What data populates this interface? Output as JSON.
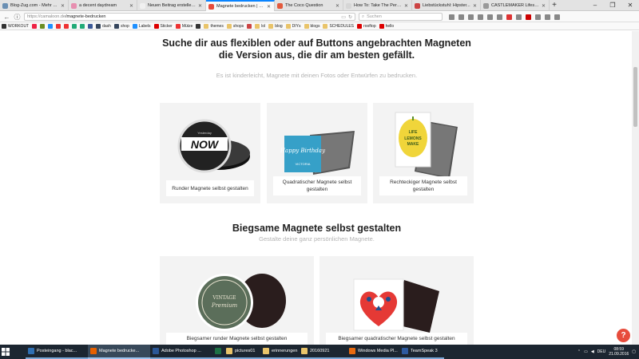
{
  "browser": {
    "tabs": [
      {
        "title": "Blog-Zug.com - Mehr Bes...",
        "color": "#6a8fb3",
        "active": false
      },
      {
        "title": "a decent daydream",
        "color": "#e78fb0",
        "active": false
      },
      {
        "title": "Neuen Beitrag erstellen - a dec...",
        "color": "#f0f0f0",
        "active": false
      },
      {
        "title": "Magnete bedrucken | Ca...",
        "color": "#e74c3c",
        "active": true
      },
      {
        "title": "The Coco Question",
        "color": "#e35a3d",
        "active": false
      },
      {
        "title": "How To: Take The Perfect Flatl...",
        "color": "#d6d6d6",
        "active": false
      },
      {
        "title": "Liebstückstuhl: Hipster...",
        "color": "#c44",
        "active": false
      },
      {
        "title": "CASTLEMAKER Lifestyle-B...",
        "color": "#999",
        "active": false
      }
    ],
    "new_tab": "+",
    "window_controls": [
      "–",
      "❐",
      "✕"
    ],
    "url_host": "https://camaloon.de",
    "url_path": "/magnete-bedrucken",
    "search_placeholder": "Suchen",
    "bookmarks": [
      {
        "label": "WORKOUT",
        "color": "#333"
      },
      {
        "label": "",
        "color": "#e24"
      },
      {
        "label": "",
        "color": "#6b8e23"
      },
      {
        "label": "",
        "color": "#1e90ff"
      },
      {
        "label": "",
        "color": "#e33"
      },
      {
        "label": "",
        "color": "#e33"
      },
      {
        "label": "",
        "color": "#2a7"
      },
      {
        "label": "",
        "color": "#2a7"
      },
      {
        "label": "",
        "color": "#3b5998"
      },
      {
        "label": "dash",
        "color": "#36465d"
      },
      {
        "label": "shop",
        "color": "#36465d"
      },
      {
        "label": "Labels",
        "color": "#1e90ff"
      },
      {
        "label": "Sticker",
        "color": "#d00"
      },
      {
        "label": "Mütze",
        "color": "#e33"
      },
      {
        "label": "",
        "color": "#333"
      },
      {
        "label": "themes",
        "color": "#e9c46a"
      },
      {
        "label": "shops",
        "color": "#e9c46a"
      },
      {
        "label": "",
        "color": "#c44"
      },
      {
        "label": "lol",
        "color": "#e9c46a"
      },
      {
        "label": "blog",
        "color": "#e9c46a"
      },
      {
        "label": "DIYs",
        "color": "#e9c46a"
      },
      {
        "label": "blogs",
        "color": "#e9c46a"
      },
      {
        "label": "SCHEDULES",
        "color": "#e9c46a"
      },
      {
        "label": "rooftop",
        "color": "#d00"
      },
      {
        "label": "hello",
        "color": "#d00"
      }
    ]
  },
  "page": {
    "headline": "Suche dir aus flexiblen oder auf Buttons angebrachten Magneten die Version aus, die dir am besten gefällt.",
    "subline": "Es ist kinderleicht, Magnete mit deinen Fotos oder Entwürfen zu bedrucken.",
    "cards_top": [
      {
        "label": "Runder Magnete selbst gestalten",
        "image_text": "NOW",
        "image_caption": "Yesterday"
      },
      {
        "label": "Quadratischer Magnete selbst gestalten",
        "image_text": "Happy Birthday",
        "image_caption": "VICTORIA"
      },
      {
        "label": "Rechteckiger Magnete selbst gestalten",
        "image_text": "WHEN LIFE GIVES YOU LEMONS MAKE LEMONADE"
      }
    ],
    "section2_title": "Biegsame Magnete selbst gestalten",
    "section2_sub": "Gestalte deine ganz persönlichen Magnete.",
    "cards_bottom": [
      {
        "label": "Biegsamer runder Magnete selbst gestalten",
        "image_text": "VINTAGE",
        "image_caption": "Premium"
      },
      {
        "label": "Biegsamer quadratischer Magnete selbst gestalten"
      }
    ],
    "help_label": "?"
  },
  "taskbar": {
    "items": [
      {
        "label": "Posteingang - blac...",
        "color": "#2f6fb3",
        "state": "open"
      },
      {
        "label": "Magnete bedrucke...",
        "color": "#e66000",
        "state": "active"
      },
      {
        "label": "Adobe Photoshop ...",
        "color": "#2b5797",
        "state": "open"
      },
      {
        "label": "",
        "color": "#1e7145",
        "state": "open"
      },
      {
        "label": "pictures01",
        "color": "#e9c46a",
        "state": "open"
      },
      {
        "label": "erinnerungen",
        "color": "#e9c46a",
        "state": "open"
      },
      {
        "label": "20160921",
        "color": "#e9c46a",
        "state": "open"
      },
      {
        "label": "Windows Media Pl...",
        "color": "#e86a10",
        "state": "open"
      },
      {
        "label": "TeamSpeak 3",
        "color": "#2d5aa0",
        "state": "open"
      }
    ],
    "lang": "DEU",
    "time": "08:59",
    "date": "21.09.2016"
  }
}
